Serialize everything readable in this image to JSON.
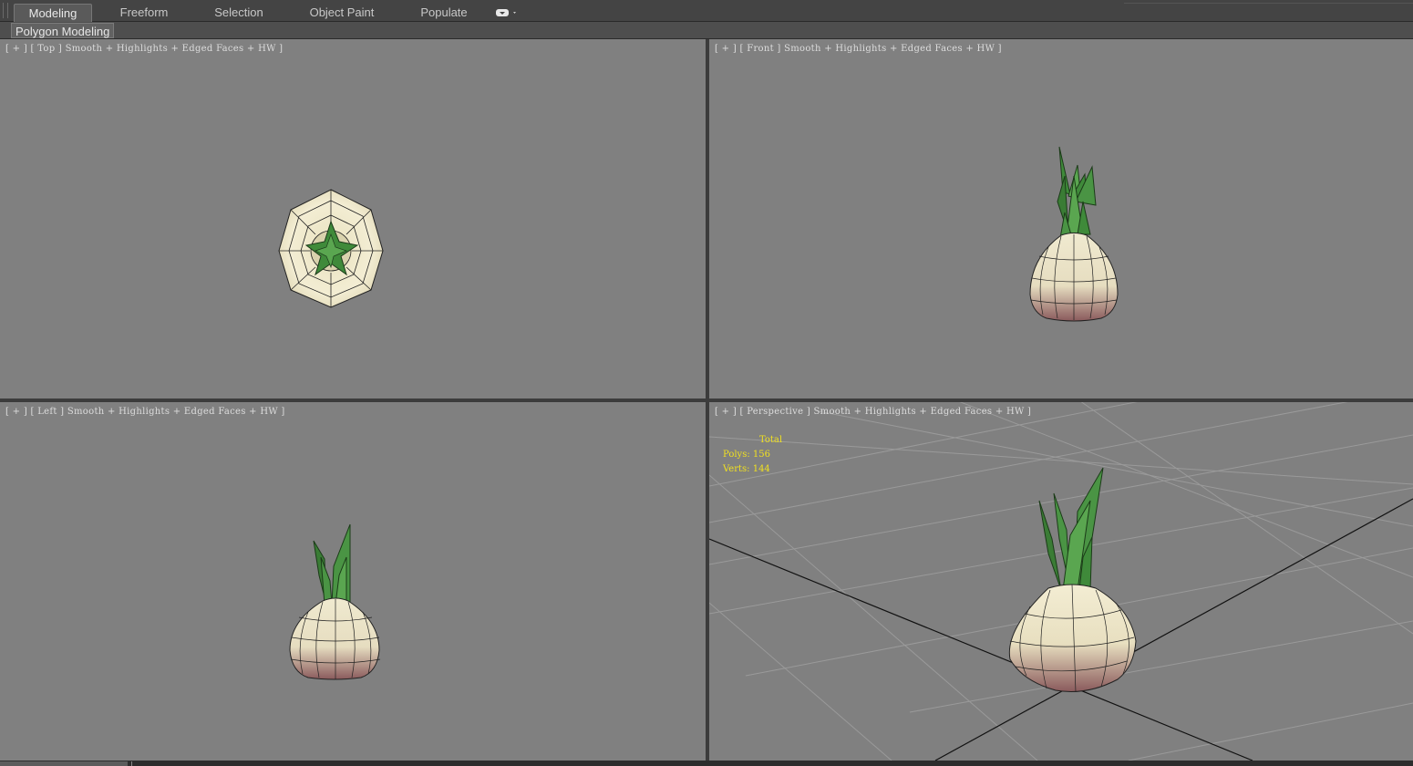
{
  "ribbon": {
    "tabs": [
      {
        "label": "Modeling",
        "active": true
      },
      {
        "label": "Freeform",
        "active": false
      },
      {
        "label": "Selection",
        "active": false
      },
      {
        "label": "Object Paint",
        "active": false
      },
      {
        "label": "Populate",
        "active": false
      }
    ],
    "extra_icon": "ribbon-options-icon",
    "panel_label": "Polygon Modeling"
  },
  "viewports": {
    "top": {
      "plus": "[ + ]",
      "view": "Top",
      "shading": "Smooth + Highlights + Edged Faces + HW ]"
    },
    "front": {
      "plus": "[ + ]",
      "view": "Front",
      "shading": "Smooth + Highlights + Edged Faces + HW ]"
    },
    "left": {
      "plus": "[ + ]",
      "view": "Left",
      "shading": "Smooth + Highlights + Edged Faces + HW ]"
    },
    "perspective": {
      "plus": "[ + ]",
      "view": "Perspective",
      "shading": "Smooth + Highlights + Edged Faces + HW ]"
    }
  },
  "stats": {
    "header": "Total",
    "polys": "Polys: 156",
    "verts": "Verts: 144"
  },
  "colors": {
    "viewport_bg": "#808080",
    "stats_text": "#f0e020",
    "bulb_light": "#f2ecd0",
    "bulb_dark": "#8a5a5c",
    "leaf": "#3f8a3a"
  }
}
